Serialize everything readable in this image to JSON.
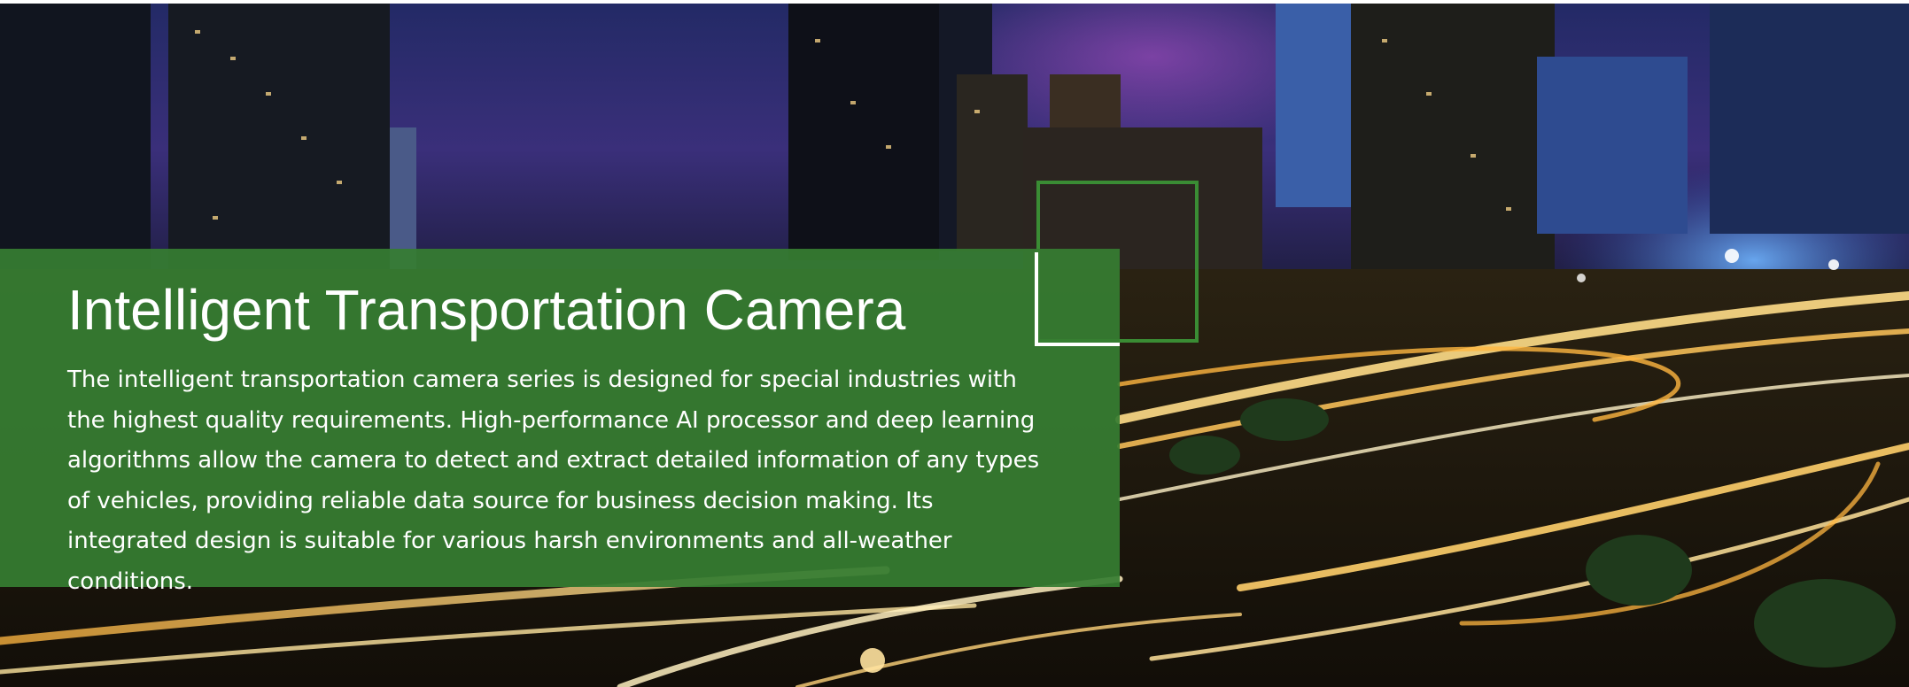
{
  "hero": {
    "title": "Intelligent Transportation Camera",
    "description": "The intelligent transportation camera series is designed for special industries with the highest quality requirements. High-performance AI processor and deep learning algorithms allow the camera to detect and extract detailed information of any types of vehicles, providing reliable data source for business decision making. Its integrated design is suitable for various harsh environments and all-weather conditions.",
    "panel_color": "#367d32",
    "accent_frame_color": "#3a8c34"
  }
}
